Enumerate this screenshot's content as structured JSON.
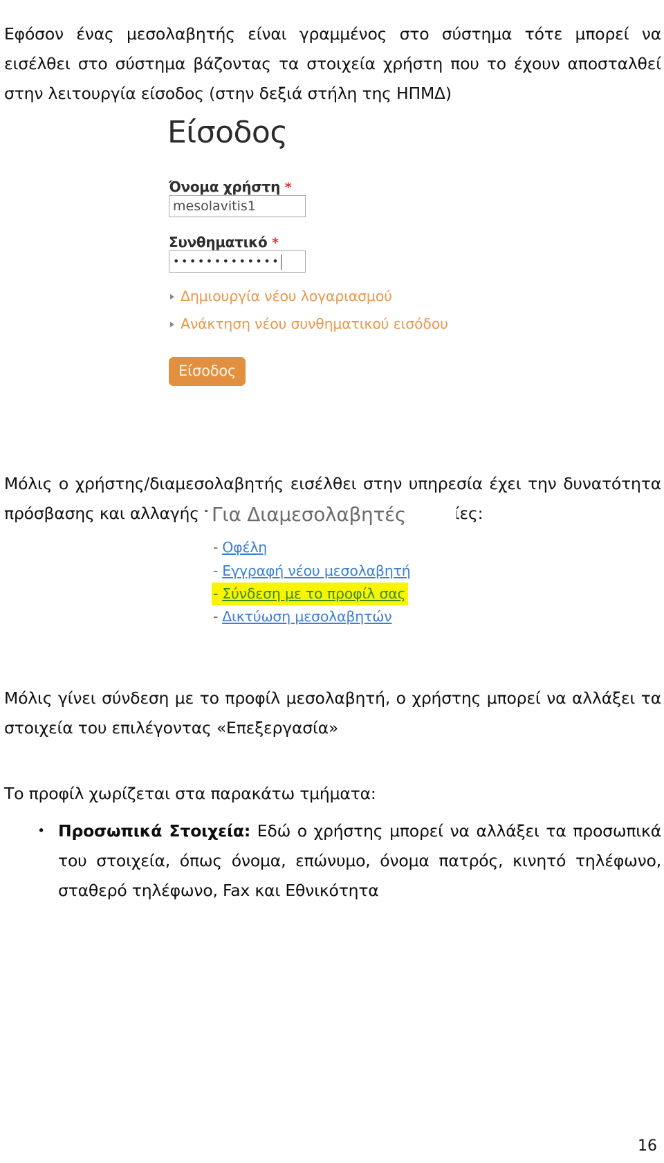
{
  "document": {
    "page_number": "16",
    "intro_paragraph": "Εφόσον ένας μεσολαβητής είναι γραμμένος στο σύστημα τότε μπορεί να εισέλθει στο σύστημα βάζοντας τα στοιχεία χρήστη που το έχουν αποσταλθεί στην λειτουργία είσοδος (στην δεξιά στήλη της ΗΠΜΔ)",
    "mid_paragraph": "Μόλις ο χρήστης/διαμεσολαβητής εισέλθει στην υπηρεσία έχει την δυνατότητα πρόσβασης και αλλαγής του προφίλ του από τις υπηρεσίες:",
    "after_menu_paragraph": "Μόλις γίνει σύνδεση με το προφίλ μεσολαβητή, ο χρήστης μπορεί να αλλάξει τα στοιχεία του επιλέγοντας «Επεξεργασία»",
    "parts_paragraph": "Το προφίλ χωρίζεται στα παρακάτω τμήματα:",
    "bullets": [
      {
        "marker": "•",
        "lead": "Προσωπικά Στοιχεία:",
        "text": " Εδώ ο χρήστης μπορεί να αλλάξει τα προσωπικά του στοιχεία, όπως όνομα, επώνυμο, όνομα πατρός, κινητό τηλέφωνο, σταθερό τηλέφωνο, Fax και Εθνικότητα"
      }
    ]
  },
  "login_screenshot": {
    "title": "Είσοδος",
    "username": {
      "label": "Όνομα χρήστη",
      "required_marker": "*",
      "value": "mesolavitis1"
    },
    "password": {
      "label": "Συνθηματικό",
      "required_marker": "*",
      "masked_value": "•••••••••••••"
    },
    "links": [
      "Δημιουργία νέου λογαριασμού",
      "Ανάκτηση νέου συνθηματικού εισόδου"
    ],
    "submit_label": "Είσοδος",
    "colors": {
      "link": "#e8984a",
      "button_bg": "#e2903f",
      "required_star": "#e3342f"
    }
  },
  "mediators_menu_screenshot": {
    "title": "Για Διαμεσολαβητές",
    "items": [
      {
        "label": "Οφέλη",
        "highlighted": false
      },
      {
        "label": "Εγγραφή νέου μεσολαβητή",
        "highlighted": false
      },
      {
        "label": "Σύνδεση με το προφίλ σας",
        "highlighted": true
      },
      {
        "label": "Δικτύωση μεσολαβητών",
        "highlighted": false
      }
    ],
    "dash": "-",
    "colors": {
      "link": "#3a7fd5",
      "highlight_bg": "#f8f403",
      "highlight_text": "#3f8a22",
      "title": "#6b6b6b"
    }
  }
}
